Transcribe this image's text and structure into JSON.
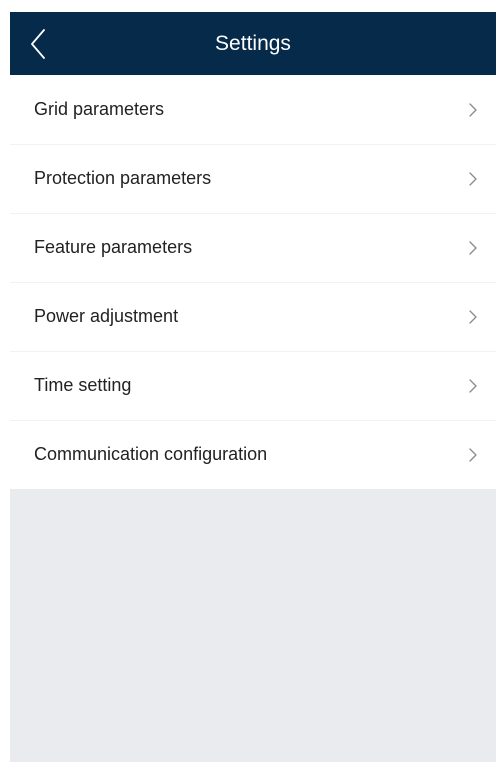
{
  "header": {
    "title": "Settings",
    "back_icon": "chevron-left-icon"
  },
  "menu": {
    "chevron_icon": "chevron-right-icon",
    "items": [
      {
        "label": "Grid parameters"
      },
      {
        "label": "Protection parameters"
      },
      {
        "label": "Feature parameters"
      },
      {
        "label": "Power adjustment"
      },
      {
        "label": "Time setting"
      },
      {
        "label": "Communication configuration"
      }
    ]
  },
  "colors": {
    "header_background": "#052a4a",
    "page_background": "#eaebef",
    "list_background": "#ffffff",
    "text_primary": "#222222",
    "chevron": "#8a8a8a"
  }
}
